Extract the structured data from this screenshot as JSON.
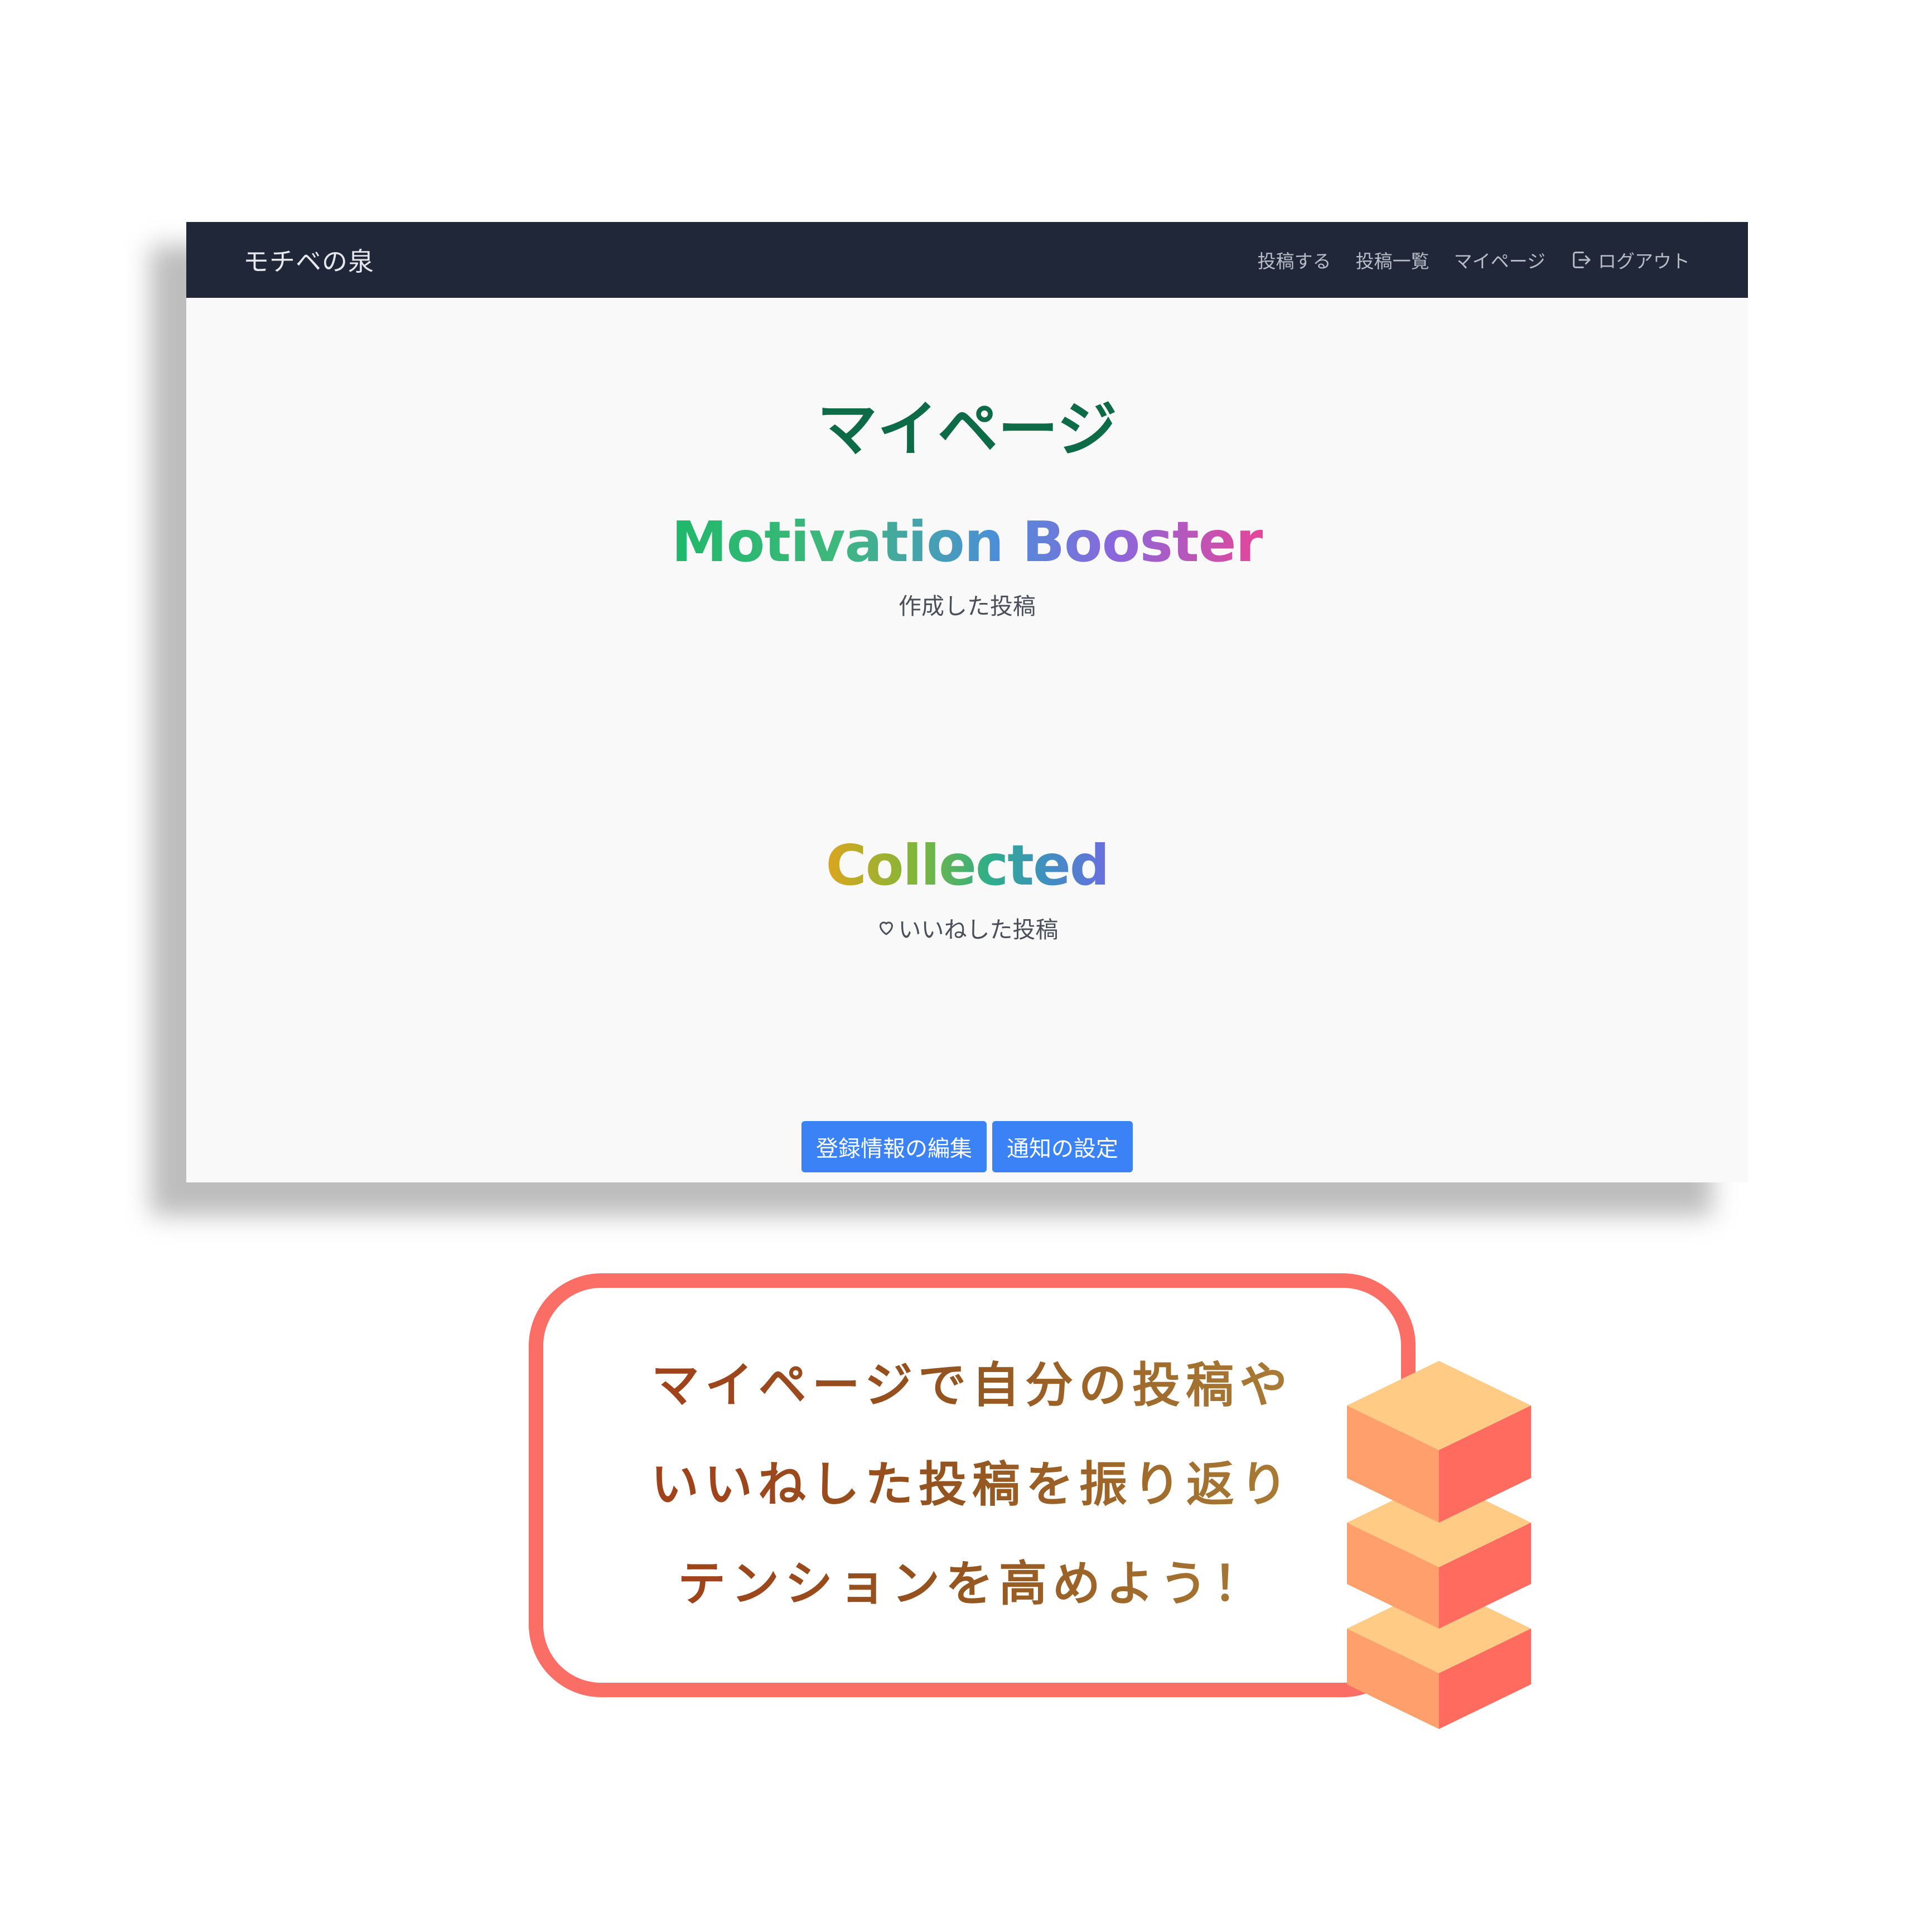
{
  "app": {
    "brand": "モチベの泉"
  },
  "nav": {
    "items": [
      {
        "label": "投稿する"
      },
      {
        "label": "投稿一覧"
      },
      {
        "label": "マイページ"
      },
      {
        "label": "ログアウト",
        "icon": "logout-icon"
      }
    ]
  },
  "main": {
    "page_title": "マイページ",
    "sections": [
      {
        "heading": "Motivation Booster",
        "subtitle": "作成した投稿"
      },
      {
        "heading": "Collected",
        "subtitle": "いいねした投稿",
        "icon": "heart-icon"
      }
    ],
    "buttons": {
      "edit_profile": "登録情報の編集",
      "notification_settings": "通知の設定"
    }
  },
  "callout": {
    "lines": [
      "マイページで自分の投稿や",
      "いいねした投稿を振り返り",
      "テンションを高めよう！"
    ]
  },
  "colors": {
    "navbar_bg": "#1f2738",
    "page_title": "#0e6b47",
    "button_bg": "#3b82f6",
    "callout_border": "#fa6e66",
    "cube_top": "#ffcb85",
    "cube_left": "#ffa06c",
    "cube_right": "#ff6b5e"
  }
}
